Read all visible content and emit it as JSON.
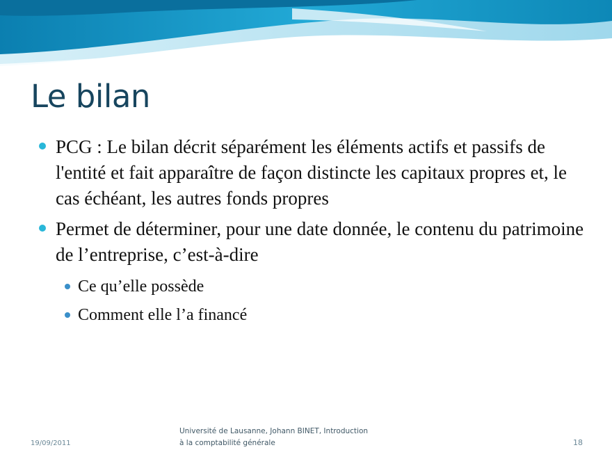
{
  "slide": {
    "title": "Le bilan",
    "bullets": [
      {
        "text": "PCG : Le bilan décrit séparément les éléments actifs et passifs de l'entité et fait apparaître de façon distincte les capitaux propres et, le cas échéant, les autres fonds propres"
      },
      {
        "text": "Permet de déterminer, pour une date donnée, le contenu du patrimoine de l’entreprise, c’est-à-dire",
        "subbullets": [
          "Ce qu’elle possède",
          "Comment elle l’a financé"
        ]
      }
    ]
  },
  "footer": {
    "date": "19/09/2011",
    "center_line1": "Université de Lausanne, Johann BINET, Introduction",
    "center_line2": "à la comptabilité générale",
    "page": "18"
  },
  "colors": {
    "title": "#17455e",
    "bullet_main": "#29b7d9",
    "bullet_sub": "#3a8fc9",
    "wave_light": "#bfe6f2",
    "wave_dark": "#0d88b7"
  }
}
